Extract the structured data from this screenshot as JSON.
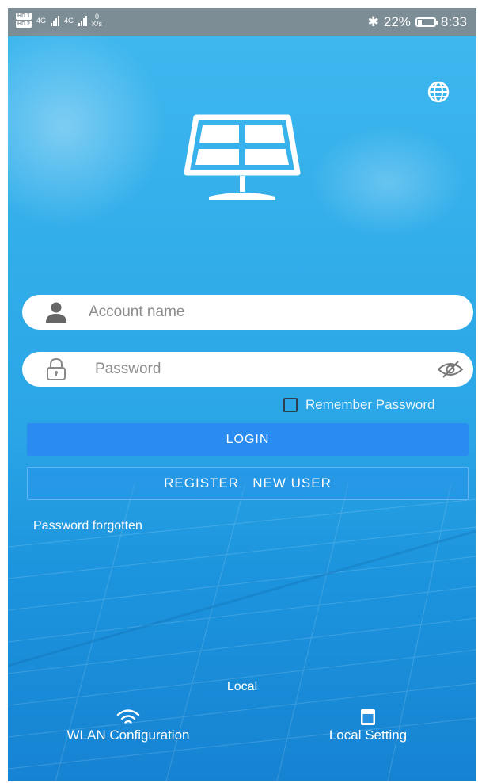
{
  "status_bar": {
    "hd1": "HD 1",
    "hd2": "HD 2",
    "net1": "4G",
    "net2": "4G",
    "speed_value": "0",
    "speed_unit": "K/s",
    "bluetooth": "✱",
    "battery_percent": "22%",
    "battery_level": 0.22,
    "time": "8:33"
  },
  "header": {
    "language_icon": "globe-icon",
    "logo_icon": "solar-panel-icon"
  },
  "form": {
    "account_placeholder": "Account name",
    "account_value": "",
    "password_placeholder": "Password",
    "password_value": "",
    "remember_label": "Remember Password",
    "remember_checked": false,
    "login_label": "LOGIN",
    "register_label": "REGISTER   NEW USER",
    "forgot_label": "Password forgotten"
  },
  "footer": {
    "local_label": "Local",
    "wlan_label": "WLAN Configuration",
    "wlan_icon": "wifi-icon",
    "local_setting_label": "Local Setting",
    "local_setting_icon": "calculator-icon"
  },
  "colors": {
    "background": "#2aa5e6",
    "login_button": "#2a8cf0",
    "status_bar": "#7d8d96"
  }
}
